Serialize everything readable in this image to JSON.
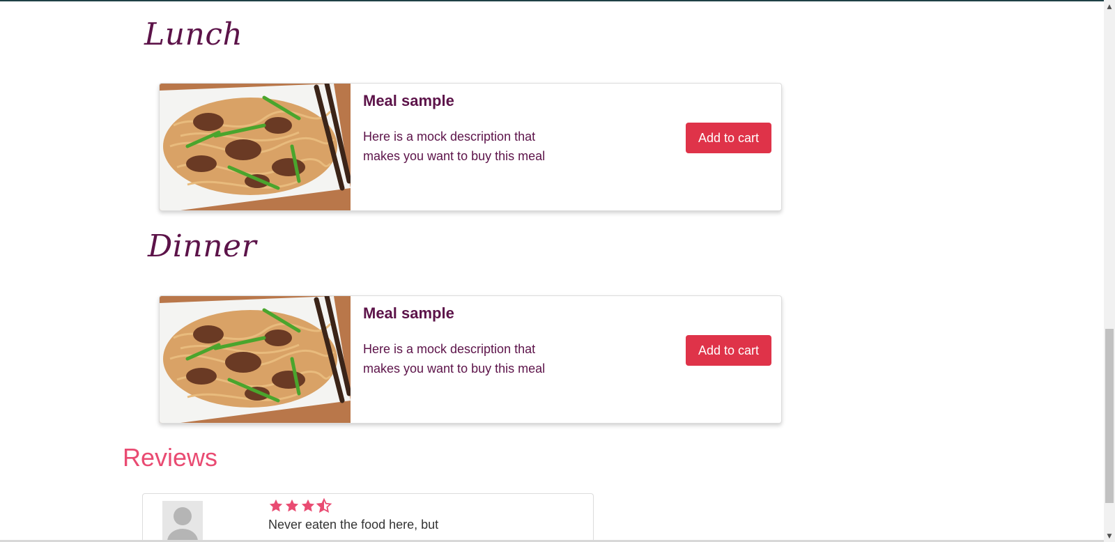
{
  "sections": [
    {
      "title": "Lunch",
      "meal": {
        "title": "Meal sample",
        "description": "Here is a mock description that makes you want to buy this meal",
        "button_label": "Add to cart",
        "image_alt": "noodle-dish-image"
      }
    },
    {
      "title": "Dinner",
      "meal": {
        "title": "Meal sample",
        "description": "Here is a mock description that makes you want to buy this meal",
        "button_label": "Add to cart",
        "image_alt": "noodle-dish-image"
      }
    }
  ],
  "reviews": {
    "title": "Reviews",
    "items": [
      {
        "rating": 4.5,
        "text": "Never eaten the food here, but"
      }
    ]
  },
  "colors": {
    "accent": "#df3349",
    "title": "#5c1349",
    "reviews_heading": "#e94b72",
    "star": "#e94b72"
  }
}
